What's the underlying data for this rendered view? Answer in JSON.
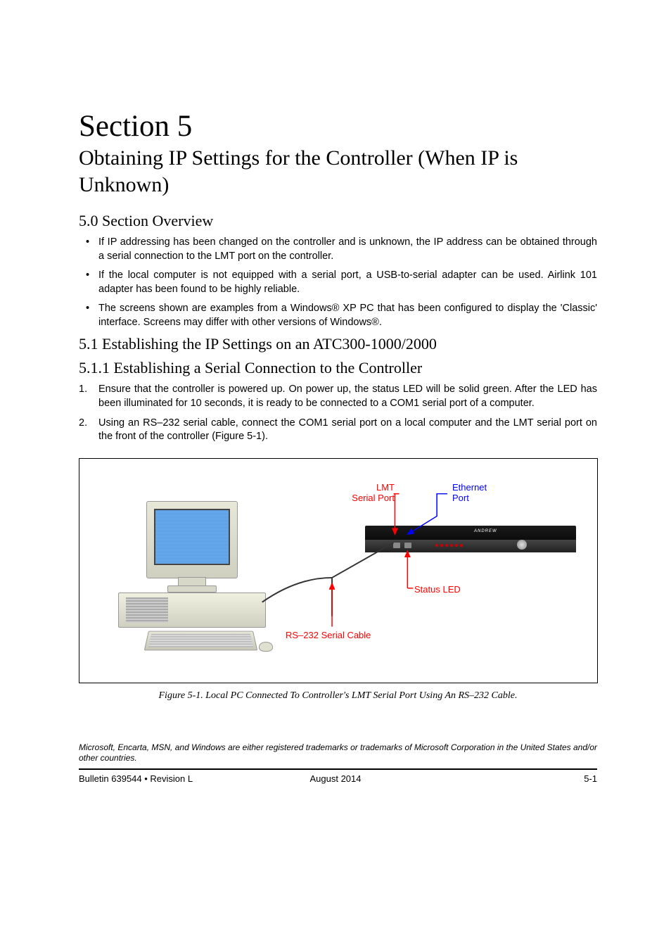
{
  "section": {
    "title": "Section 5",
    "subtitle": "Obtaining IP Settings for the Controller (When IP is Unknown)"
  },
  "overview": {
    "heading": "5.0 Section Overview",
    "bullets": [
      "If IP addressing has been changed on the controller and is unknown, the IP address can be obtained through a serial connection to the LMT port on the controller.",
      "If the local computer is not equipped with a serial port, a USB-to-serial adapter can be used. Airlink 101 adapter has been found to be highly reliable.",
      "The screens shown are examples from a Windows® XP PC that has been configured to display the 'Classic' interface. Screens may differ with other versions of Windows®."
    ]
  },
  "h51": "5.1 Establishing the IP Settings on an ATC300-1000/2000",
  "h511": "5.1.1 Establishing a Serial Connection to the Controller",
  "steps": [
    "Ensure that the controller is powered up. On power up, the status LED will be solid green. After the LED has been illuminated for 10 seconds, it is ready to be connected to a COM1 serial port of a computer.",
    "Using an RS–232 serial cable, connect the COM1 serial port on a local computer and the LMT serial port on the front of the controller (Figure 5-1)."
  ],
  "figure": {
    "labels": {
      "lmt_line1": "LMT",
      "lmt_line2": "Serial Port",
      "ethernet_line1": "Ethernet",
      "ethernet_line2": "Port",
      "status_led": "Status LED",
      "cable": "RS–232 Serial Cable"
    },
    "device_logo": "ANDREW",
    "caption": "Figure 5-1.  Local PC Connected To Controller's LMT Serial Port Using An RS–232 Cable."
  },
  "trademark": "Microsoft, Encarta, MSN, and Windows are either registered trademarks or trademarks of Microsoft Corporation in the United States and/or other countries.",
  "footer": {
    "left": "Bulletin 639544  •  Revision L",
    "center": "August 2014",
    "right": "5-1"
  }
}
